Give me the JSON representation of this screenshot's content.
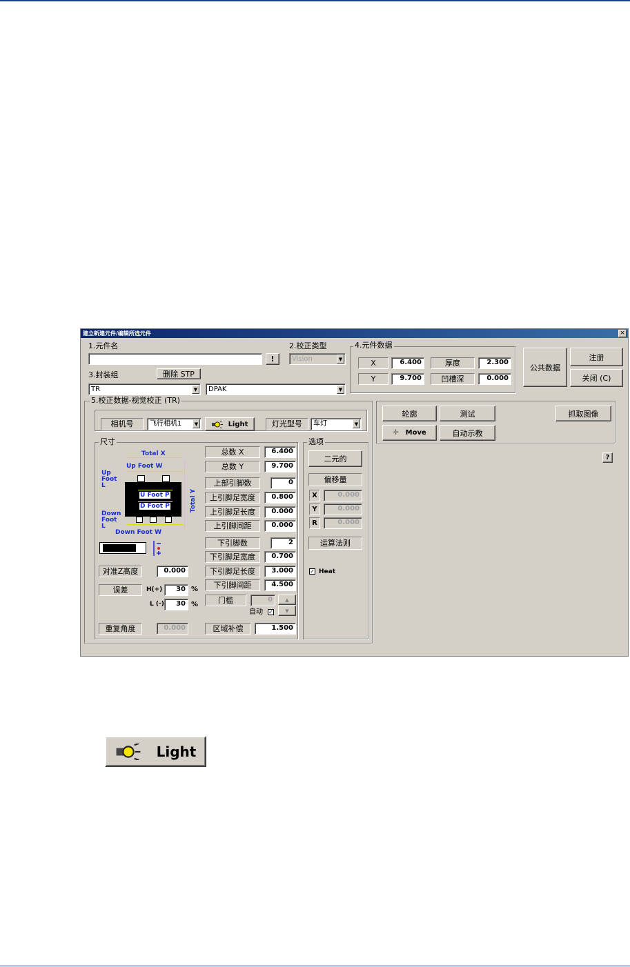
{
  "window": {
    "title": "建立新建元件/编辑所选元件",
    "close": "×"
  },
  "sec1": {
    "label": "1.元件名",
    "name_value": "",
    "bang": "!"
  },
  "sec2": {
    "label": "2.校正类型",
    "value": "Vision"
  },
  "sec3": {
    "label": "3.封装组",
    "delete_btn": "删除 STP",
    "combo1": "TR",
    "combo2": "DPAK"
  },
  "sec4": {
    "label": "4.元件数据",
    "x_label": "X",
    "x_value": "6.400",
    "thick_label": "厚度",
    "thick_value": "2.300",
    "y_label": "Y",
    "y_value": "9.700",
    "groove_label": "凹槽深",
    "groove_value": "0.000"
  },
  "right_buttons": {
    "public": "公共数据",
    "register": "注册",
    "close": "关闭 (C)"
  },
  "sec5": {
    "label": "5.校正数据-视觉校正 (TR)",
    "camera_label": "相机号",
    "camera_value": "飞行相机1",
    "light": "Light",
    "lamp_label": "灯光型号",
    "lamp_value": "车灯",
    "size_label": "尺寸",
    "diagram": {
      "total_x": "Total X",
      "up_foot_w": "Up Foot W",
      "up_foot_l": "Up\nFoot\nL",
      "u_foot_p": "U Foot P",
      "d_foot_p": "D Foot P",
      "total_y": "Total Y",
      "down_foot_l": "Down\nFoot\nL",
      "down_foot_w": "Down Foot W"
    },
    "fields": {
      "total_x": {
        "label": "总数 X",
        "value": "6.400"
      },
      "total_y": {
        "label": "总数 Y",
        "value": "9.700"
      },
      "up_count": {
        "label": "上部引脚数",
        "value": "0"
      },
      "up_w": {
        "label": "上引脚足宽度",
        "value": "0.800"
      },
      "up_l": {
        "label": "上引脚足长度",
        "value": "0.000"
      },
      "up_p": {
        "label": "上引脚间距",
        "value": "0.000"
      },
      "down_count": {
        "label": "下引脚数",
        "value": "2"
      },
      "down_w": {
        "label": "下引脚足宽度",
        "value": "0.700"
      },
      "down_l": {
        "label": "下引脚足长度",
        "value": "3.000"
      },
      "down_p": {
        "label": "下引脚间距",
        "value": "4.500"
      },
      "threshold": {
        "label": "门槛",
        "value": "0"
      },
      "auto": "自动",
      "area": {
        "label": "区域补偿",
        "value": "1.500"
      }
    },
    "align_z": {
      "label": "对准Z高度",
      "value": "0.000"
    },
    "error": {
      "label": "误差",
      "h_label": "H(+)",
      "h_value": "30",
      "l_label": "L (-)",
      "l_value": "30",
      "unit": "%"
    },
    "repeat": {
      "label": "重复角度",
      "value": "0.000"
    },
    "options": {
      "label": "选项",
      "binary": "二元的",
      "offset": "偏移量",
      "ox": {
        "label": "X",
        "value": "0.000"
      },
      "oy": {
        "label": "Y",
        "value": "0.000"
      },
      "or": {
        "label": "R",
        "value": "0.000"
      },
      "rule": "运算法则",
      "heat": "Heat"
    }
  },
  "tools": {
    "contour": "轮廓",
    "test": "测试",
    "capture": "抓取图像",
    "move": "Move",
    "auto_teach": "自动示教",
    "help": "?"
  },
  "zoom": {
    "light": "Light"
  }
}
